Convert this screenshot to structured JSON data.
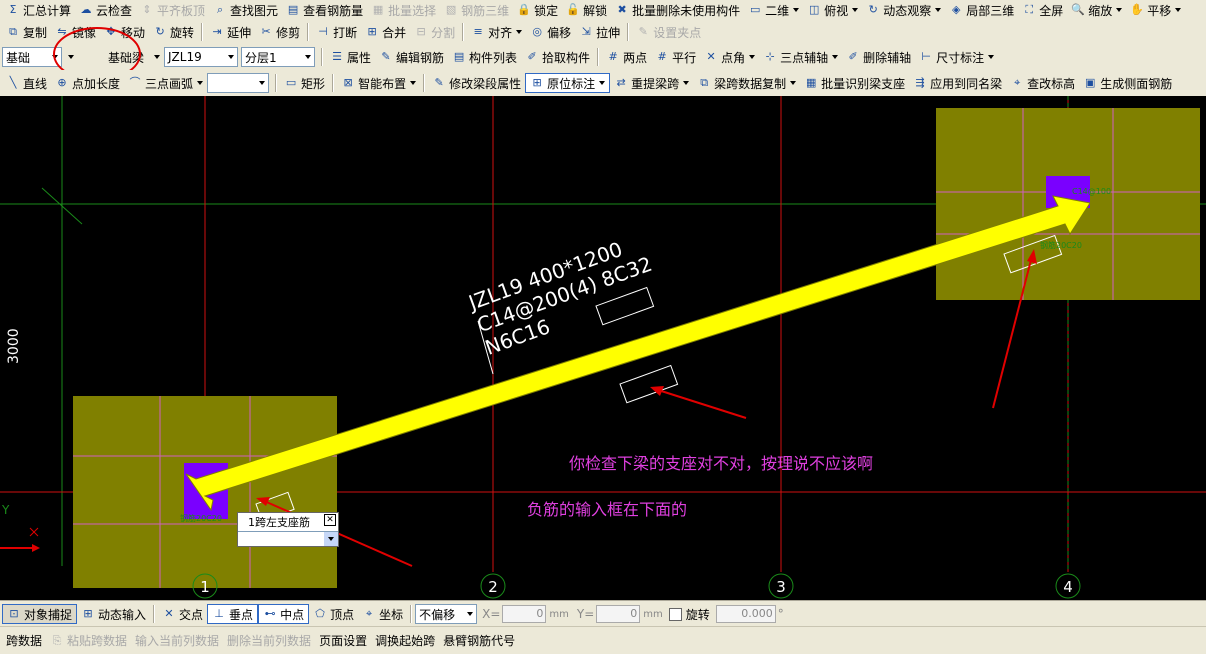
{
  "toolbar_top": [
    "汇总计算",
    "云检查",
    "平齐板顶",
    "查找图元",
    "查看钢筋量",
    "批量选择",
    "钢筋三维",
    "锁定",
    "解锁",
    "批量删除未使用构件",
    "二维",
    "俯视",
    "动态观察",
    "局部三维",
    "全屏",
    "缩放",
    "平移"
  ],
  "toolbar_edit": {
    "items": [
      "复制",
      "镜像",
      "移动",
      "旋转",
      "延伸",
      "修剪",
      "打断",
      "合并",
      "分割",
      "对齐",
      "偏移",
      "拉伸",
      "设置夹点"
    ],
    "disabled": [
      "分割",
      "设置夹点"
    ]
  },
  "toolbar_component": {
    "category": "基础",
    "type": "基础梁",
    "member": "JZL19",
    "layer": "分层1",
    "items": [
      "属性",
      "编辑钢筋",
      "构件列表",
      "拾取构件",
      "两点",
      "平行",
      "点角",
      "三点辅轴",
      "删除辅轴",
      "尺寸标注"
    ]
  },
  "toolbar_draw": {
    "items": [
      "直线",
      "点加长度",
      "三点画弧"
    ],
    "shape": "矩形",
    "more": [
      "智能布置",
      "修改梁段属性",
      "原位标注",
      "重提梁跨",
      "梁跨数据复制",
      "批量识别梁支座",
      "应用到同名梁",
      "查改标高",
      "生成侧面钢筋"
    ],
    "active": "原位标注"
  },
  "canvas": {
    "beam_label": [
      "JZL19 400*1200",
      "C14@200(4) 8C32",
      "N6C16"
    ],
    "dimension": "3000",
    "axes": [
      "1",
      "2",
      "3",
      "4"
    ],
    "axis_y_label": "Y",
    "annotation_1": "你检查下梁的支座对不对，按理说不应该啊",
    "annotation_2": "负筋的输入框在下面的",
    "popup_label": "1跨左支座筋",
    "column_small_text_1": "钢筋20C20",
    "column_small_text_2": "C14@100",
    "colors": {
      "canvas": "#000000",
      "grid_red": "#d01010",
      "grid_green": "#1a8a1a",
      "column_fill": "#808000",
      "column_purple": "#7a00ff",
      "arrow_yellow": "#ffff00",
      "note_magenta": "#e040e0"
    }
  },
  "status_bar": {
    "snap": [
      "对象捕捉",
      "动态输入"
    ],
    "points": [
      "交点",
      "垂点",
      "中点",
      "顶点",
      "坐标"
    ],
    "offset_mode": "不偏移",
    "x_label": "X=",
    "x_value": "0",
    "y_label": "Y=",
    "y_value": "0",
    "unit": "mm",
    "rotate_label": "旋转",
    "rotate_value": "0.000",
    "degree": "°"
  },
  "bottom_bar": [
    "跨数据",
    "粘贴跨数据",
    "输入当前列数据",
    "删除当前列数据",
    "页面设置",
    "调换起始跨",
    "悬臂钢筋代号"
  ],
  "bottom_bar_disabled": [
    "粘贴跨数据",
    "输入当前列数据",
    "删除当前列数据"
  ]
}
